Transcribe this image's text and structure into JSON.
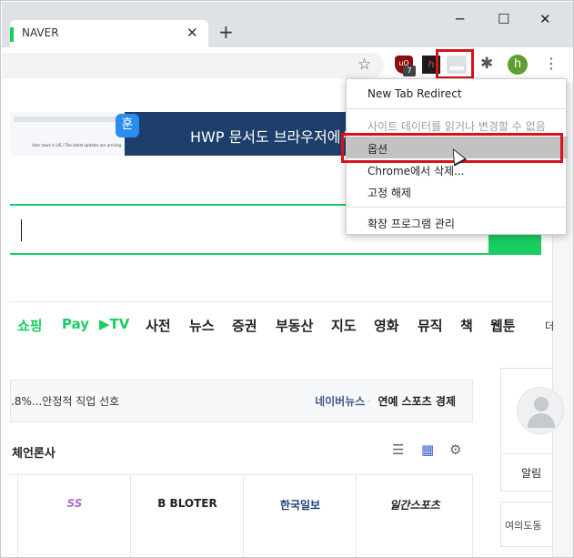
{
  "browser": {
    "tab": {
      "title": "NAVER",
      "close": "✕"
    },
    "new_tab": "+",
    "window": {
      "minimize": "─",
      "maximize": "☐",
      "close": "✕"
    },
    "toolbar": {
      "star": "☆",
      "ublock_badge": "7",
      "ublock_label": "uO",
      "hwp_label": "h",
      "avatar_letter": "h",
      "puzzle": "✱",
      "kebab": "⋮"
    }
  },
  "page": {
    "banner": {
      "logo": "훈",
      "screenshot_text": "User news in US / The latest updates are arriving",
      "headline": "HWP 문서도 브라우저에서"
    },
    "search": {
      "button_icon": "⌕"
    },
    "nav": [
      {
        "label": "쇼핑",
        "green": true
      },
      {
        "label": "Pay",
        "green": true
      },
      {
        "label": "▶TV",
        "green": true
      },
      {
        "label": "사전",
        "green": false
      },
      {
        "label": "뉴스",
        "green": false
      },
      {
        "label": "증권",
        "green": false
      },
      {
        "label": "부동산",
        "green": false
      },
      {
        "label": "지도",
        "green": false
      },
      {
        "label": "영화",
        "green": false
      },
      {
        "label": "뮤직",
        "green": false
      },
      {
        "label": "책",
        "green": false
      },
      {
        "label": "웹툰",
        "green": false
      },
      {
        "label": "더",
        "green": false
      }
    ],
    "news": {
      "headline": ".8%...안정적 직업 선호",
      "links": [
        "네이버뉴스",
        "연예",
        "스포츠",
        "경제"
      ]
    },
    "press": {
      "title": "체언론사",
      "logos": [
        "SS",
        "B BLOTER",
        "한국일보",
        "일간스포츠"
      ]
    },
    "side": {
      "alarm": "알림",
      "weather": "여의도동"
    }
  },
  "context_menu": {
    "items": [
      {
        "label": "New Tab Redirect",
        "state": "normal"
      },
      {
        "label": "사이트 데이터를 읽거나 변경할 수 없음",
        "state": "disabled"
      },
      {
        "label": "옵션",
        "state": "hover"
      },
      {
        "label": "Chrome에서 삭제...",
        "state": "normal"
      },
      {
        "label": "고정 해제",
        "state": "normal"
      },
      {
        "label": "확장 프로그램 관리",
        "state": "normal"
      }
    ]
  },
  "colors": {
    "naver_green": "#19ce60",
    "highlight_red": "#d9111a",
    "tabstrip": "#dee1e6",
    "banner_navy": "#1e3f6b"
  }
}
